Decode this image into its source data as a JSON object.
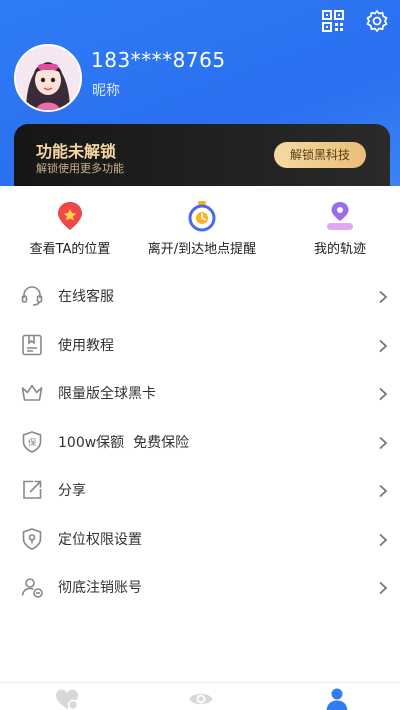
{
  "profile": {
    "phone": "183****8765",
    "nickname": "昵称"
  },
  "top_icons": [
    "qr-code-icon",
    "gear-icon"
  ],
  "unlock_card": {
    "title": "功能未解锁",
    "subtitle": "解锁使用更多功能",
    "button_label": "解锁黑科技"
  },
  "features": [
    {
      "label": "查看TA的位置",
      "icon": "location-pin-icon"
    },
    {
      "label": "离开/到达地点提醒",
      "icon": "alarm-clock-icon"
    },
    {
      "label": "我的轨迹",
      "icon": "track-route-icon"
    }
  ],
  "menu": [
    {
      "label": "在线客服",
      "icon": "headset-icon"
    },
    {
      "label": "使用教程",
      "icon": "tutorial-book-icon"
    },
    {
      "label": "限量版全球黑卡",
      "icon": "crown-icon"
    },
    {
      "label": "100w保额  免费保险",
      "icon": "insurance-shield-icon"
    },
    {
      "label": "分享",
      "icon": "share-icon"
    },
    {
      "label": "定位权限设置",
      "icon": "location-permission-icon"
    },
    {
      "label": "彻底注销账号",
      "icon": "delete-account-icon"
    }
  ],
  "tabbar": [
    {
      "icon": "heart-location-icon",
      "active": false
    },
    {
      "icon": "eye-icon",
      "active": false
    },
    {
      "icon": "person-icon",
      "active": true
    }
  ],
  "colors": {
    "header_blue": "#2f7cf6",
    "gold_text": "#f5d8a0",
    "feature_red": "#f04848",
    "feature_blue": "#4a68f0",
    "feature_purple": "#9b6cf0",
    "active_tab": "#2f7cf6",
    "inactive_tab": "#d8d8d8"
  }
}
